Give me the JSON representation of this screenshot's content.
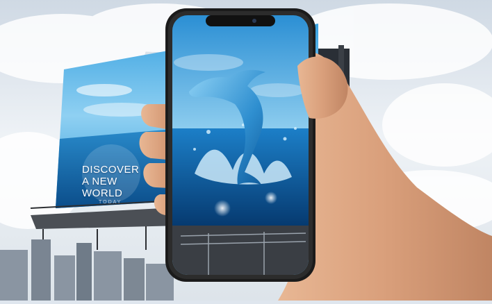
{
  "billboard": {
    "headline_line1": "DISCOVER",
    "headline_line2": "A NEW WORLD",
    "subtext": "TODAY"
  },
  "colors": {
    "sky": "#e9eef4",
    "billboard_blue": "#1e8fd6",
    "ocean_deep": "#0a4f8c",
    "phone_frame": "#1b1b1b",
    "dolphin": "#5cb6e8",
    "skin": "#d9a37f"
  },
  "icons": [
    "phone-notch-icon",
    "dolphin-icon",
    "water-splash-icon"
  ]
}
